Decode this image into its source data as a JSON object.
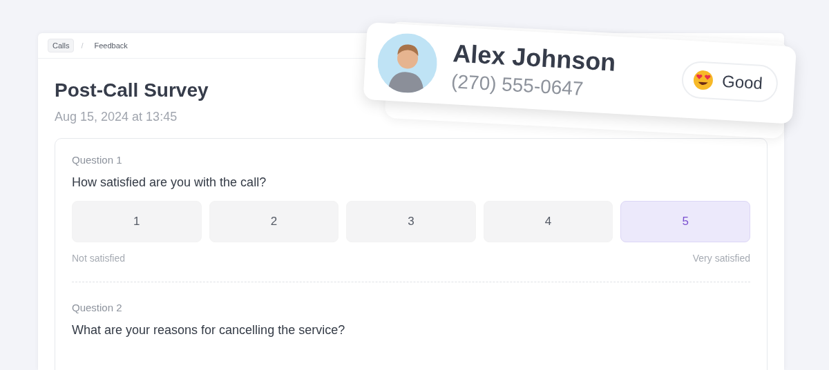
{
  "breadcrumb": [
    {
      "label": "Calls",
      "selected": true
    },
    {
      "label": "Feedback",
      "selected": false
    }
  ],
  "breadcrumb_separator": "/",
  "title": "Post-Call Survey",
  "date": "Aug 15, 2024 at 13:45",
  "questions": [
    {
      "label": "Question 1",
      "text": "How satisfied are you with the call?",
      "kind": "scale",
      "options": [
        {
          "label": "1",
          "selected": false
        },
        {
          "label": "2",
          "selected": false
        },
        {
          "label": "3",
          "selected": false
        },
        {
          "label": "4",
          "selected": false
        },
        {
          "label": "5",
          "selected": true
        }
      ],
      "min_label": "Not satisfied",
      "max_label": "Very satisfied"
    },
    {
      "label": "Question 2",
      "text": "What are your reasons for cancelling the service?",
      "kind": "text"
    }
  ],
  "contact": {
    "name": "Alex Johnson",
    "phone": "(270) 555-0647",
    "rating": "Good"
  }
}
